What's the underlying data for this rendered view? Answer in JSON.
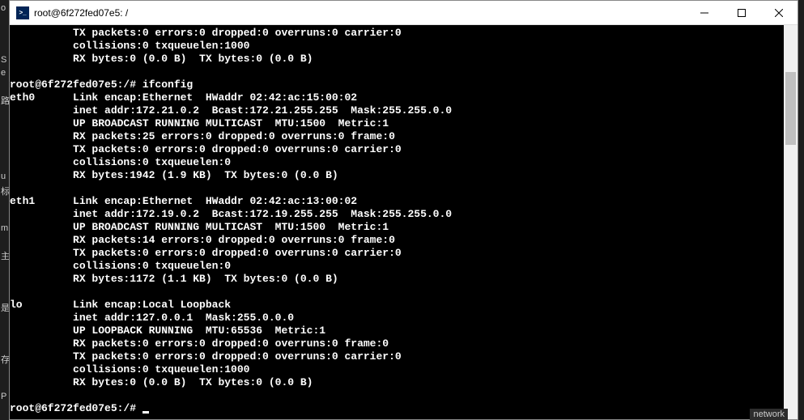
{
  "window": {
    "title": "root@6f272fed07e5: /"
  },
  "terminal": {
    "lines": [
      "          TX packets:0 errors:0 dropped:0 overruns:0 carrier:0",
      "          collisions:0 txqueuelen:1000",
      "          RX bytes:0 (0.0 B)  TX bytes:0 (0.0 B)",
      "",
      "root@6f272fed07e5:/# ifconfig",
      "eth0      Link encap:Ethernet  HWaddr 02:42:ac:15:00:02",
      "          inet addr:172.21.0.2  Bcast:172.21.255.255  Mask:255.255.0.0",
      "          UP BROADCAST RUNNING MULTICAST  MTU:1500  Metric:1",
      "          RX packets:25 errors:0 dropped:0 overruns:0 frame:0",
      "          TX packets:0 errors:0 dropped:0 overruns:0 carrier:0",
      "          collisions:0 txqueuelen:0",
      "          RX bytes:1942 (1.9 KB)  TX bytes:0 (0.0 B)",
      "",
      "eth1      Link encap:Ethernet  HWaddr 02:42:ac:13:00:02",
      "          inet addr:172.19.0.2  Bcast:172.19.255.255  Mask:255.255.0.0",
      "          UP BROADCAST RUNNING MULTICAST  MTU:1500  Metric:1",
      "          RX packets:14 errors:0 dropped:0 overruns:0 frame:0",
      "          TX packets:0 errors:0 dropped:0 overruns:0 carrier:0",
      "          collisions:0 txqueuelen:0",
      "          RX bytes:1172 (1.1 KB)  TX bytes:0 (0.0 B)",
      "",
      "lo        Link encap:Local Loopback",
      "          inet addr:127.0.0.1  Mask:255.0.0.0",
      "          UP LOOPBACK RUNNING  MTU:65536  Metric:1",
      "          RX packets:0 errors:0 dropped:0 overruns:0 frame:0",
      "          TX packets:0 errors:0 dropped:0 overruns:0 carrier:0",
      "          collisions:0 txqueuelen:1000",
      "          RX bytes:0 (0.0 B)  TX bytes:0 (0.0 B)",
      "",
      "root@6f272fed07e5:/# "
    ]
  },
  "left_fragments": [
    "o",
    "",
    "",
    "",
    "S",
    "e",
    "",
    "路",
    "",
    "",
    "",
    "",
    "",
    "u",
    "标",
    "",
    "",
    "m",
    "",
    "主",
    "",
    "",
    "",
    "是",
    "",
    "",
    "",
    "存",
    "",
    "",
    "P"
  ],
  "bottom_fragment": "network"
}
